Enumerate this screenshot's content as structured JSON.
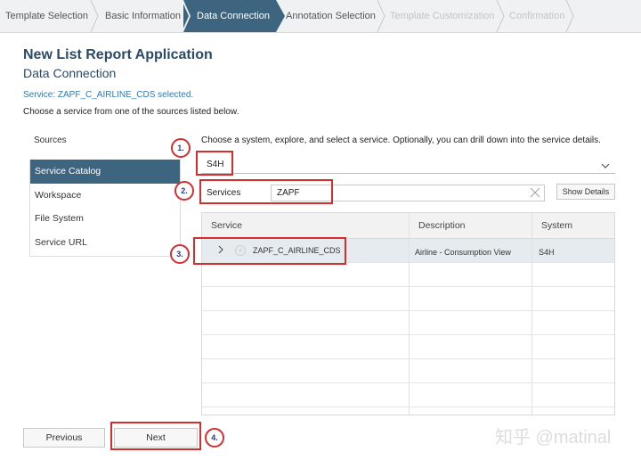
{
  "wizard": {
    "steps": [
      {
        "label": "Template Selection",
        "state": "done"
      },
      {
        "label": "Basic Information",
        "state": "done"
      },
      {
        "label": "Data Connection",
        "state": "active"
      },
      {
        "label": "Annotation Selection",
        "state": "done"
      },
      {
        "label": "Template Customization",
        "state": "disabled"
      },
      {
        "label": "Confirmation",
        "state": "disabled"
      }
    ]
  },
  "header": {
    "title": "New List Report Application",
    "subtitle": "Data Connection",
    "selected_message": "Service: ZAPF_C_AIRLINE_CDS selected.",
    "instruction": "Choose a service from one of the sources listed below."
  },
  "sources": {
    "label": "Sources",
    "items": [
      {
        "label": "Service Catalog",
        "active": true
      },
      {
        "label": "Workspace",
        "active": false
      },
      {
        "label": "File System",
        "active": false
      },
      {
        "label": "Service URL",
        "active": false
      }
    ]
  },
  "catalog": {
    "choose_message": "Choose a system, explore, and select a service. Optionally, you can drill down into the service details.",
    "system_value": "S4H",
    "services_label": "Services",
    "services_value": "ZAPF",
    "show_details_label": "Show Details",
    "table": {
      "columns": [
        "Service",
        "Description",
        "System"
      ],
      "rows": [
        {
          "service": "ZAPF_C_AIRLINE_CDS",
          "description": "Airline - Consumption View",
          "system": "S4H"
        }
      ]
    }
  },
  "footer": {
    "previous_label": "Previous",
    "next_label": "Next"
  },
  "annotations": [
    "1.",
    "2.",
    "3.",
    "4."
  ],
  "watermark": "知乎 @matinal",
  "colors": {
    "accent": "#3e6580",
    "title": "#2b4a66",
    "annotation_red": "#d32f2f",
    "annotation_number": "#2a3a8c"
  }
}
